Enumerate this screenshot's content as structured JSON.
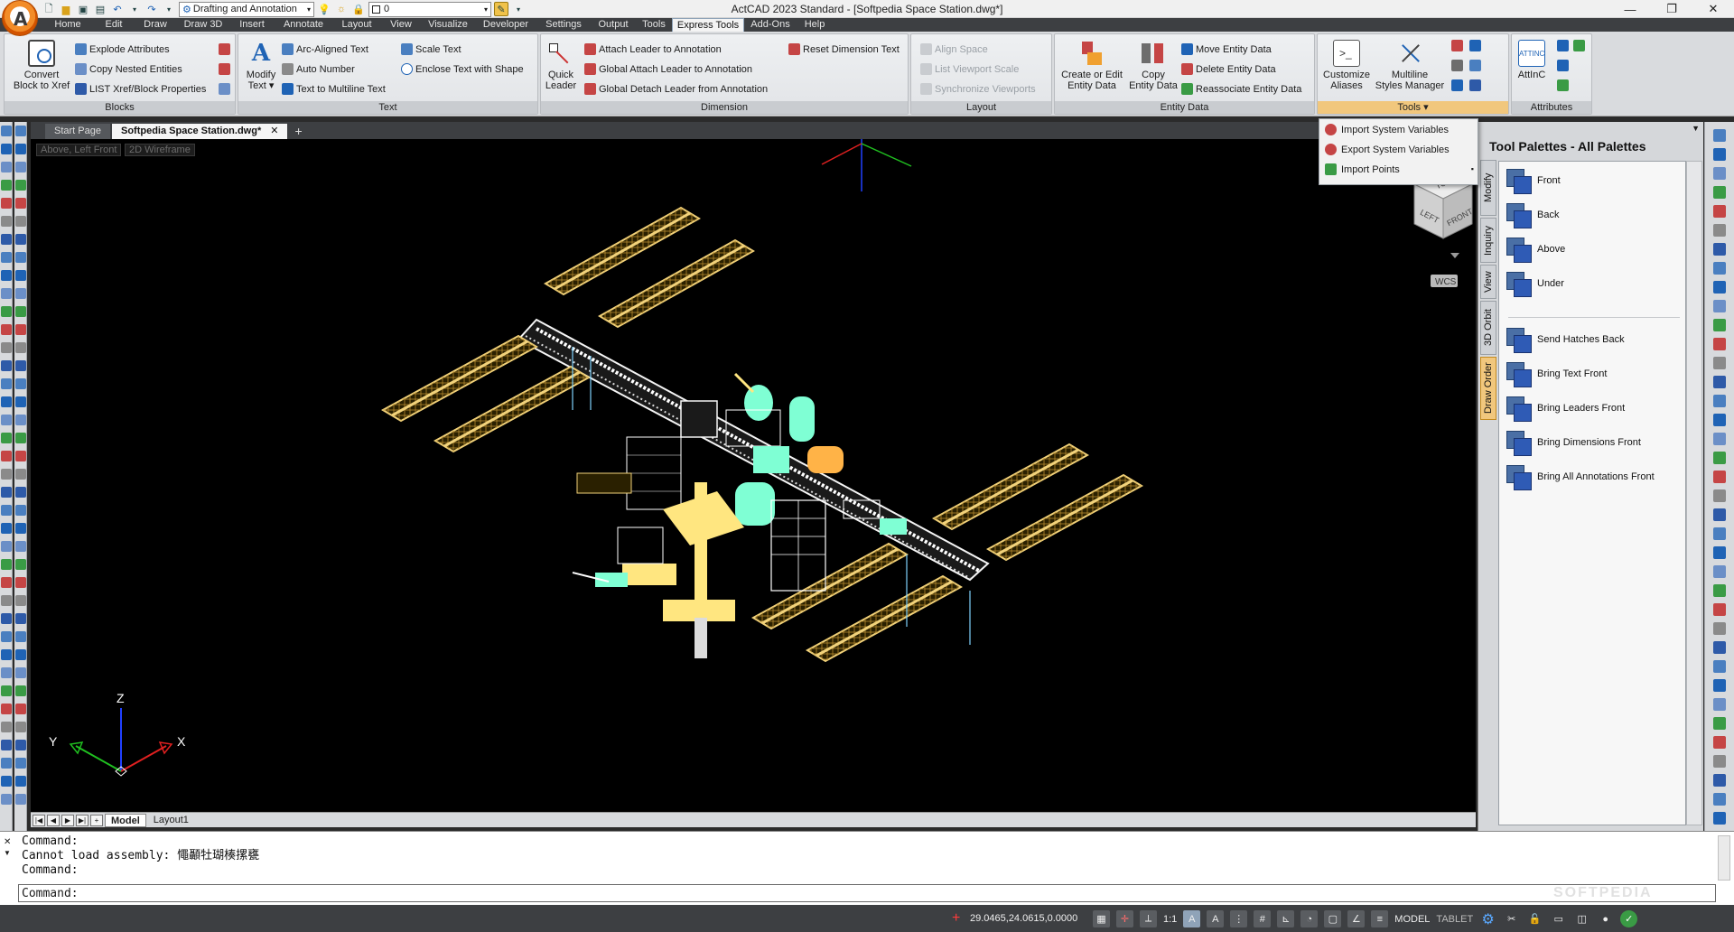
{
  "titlebar": {
    "title": "ActCAD 2023 Standard - [Softpedia Space Station.dwg*]",
    "workspace": "Drafting and Annotation",
    "layer": "0",
    "minimize": "—",
    "restore": "❐",
    "close": "✕"
  },
  "menu": {
    "tabs": [
      {
        "label": "Home",
        "w": 58
      },
      {
        "label": "Edit",
        "w": 44
      },
      {
        "label": "Draw",
        "w": 48
      },
      {
        "label": "Draw 3D",
        "w": 58
      },
      {
        "label": "Insert",
        "w": 50
      },
      {
        "label": "Annotate",
        "w": 64
      },
      {
        "label": "Layout",
        "w": 54
      },
      {
        "label": "View",
        "w": 44
      },
      {
        "label": "Visualize",
        "w": 60
      },
      {
        "label": "Developer",
        "w": 68
      },
      {
        "label": "Settings",
        "w": 60
      },
      {
        "label": "Output",
        "w": 50
      },
      {
        "label": "Tools",
        "w": 40
      },
      {
        "label": "Express Tools",
        "w": 80
      },
      {
        "label": "Add-Ons",
        "w": 58
      },
      {
        "label": "Help",
        "w": 40
      }
    ],
    "active_index": 13
  },
  "ribbon": {
    "blocks": {
      "title": "Blocks",
      "convert_line1": "Convert",
      "convert_line2": "Block to Xref",
      "explode_attributes": "Explode Attributes",
      "copy_nested": "Copy Nested Entities",
      "list_xref": "LIST Xref/Block Properties"
    },
    "text": {
      "title": "Text",
      "modify_line1": "Modify",
      "modify_line2": "Text ▾",
      "arc_aligned": "Arc-Aligned Text",
      "auto_number": "Auto Number",
      "text_to_mtext": "Text to Multiline Text",
      "scale_text": "Scale Text",
      "enclose_text": "Enclose Text with Shape"
    },
    "dimension": {
      "title": "Dimension",
      "quick_line1": "Quick",
      "quick_line2": "Leader",
      "attach_leader": "Attach Leader to Annotation",
      "global_attach": "Global Attach Leader to Annotation",
      "global_detach": "Global Detach Leader from Annotation",
      "reset_dim": "Reset Dimension Text"
    },
    "layout": {
      "title": "Layout",
      "align_space": "Align Space",
      "list_viewport": "List Viewport Scale",
      "sync_viewports": "Synchronize Viewports"
    },
    "entity_data": {
      "title": "Entity Data",
      "create_line1": "Create or Edit",
      "create_line2": "Entity Data",
      "copy_line1": "Copy",
      "copy_line2": "Entity Data",
      "move": "Move Entity Data",
      "delete": "Delete Entity Data",
      "reassociate": "Reassociate Entity Data"
    },
    "tools": {
      "title": "Tools ▾",
      "aliases_line1": "Customize",
      "aliases_line2": "Aliases",
      "mls_line1": "Multiline",
      "mls_line2": "Styles Manager"
    },
    "attributes": {
      "title": "Attributes",
      "attinc": "AttInC",
      "attinc_icon_text": "ATTINC"
    }
  },
  "tools_dropdown": {
    "import_sysvars": "Import System Variables",
    "export_sysvars": "Export System Variables",
    "import_points": "Import Points"
  },
  "documents": {
    "tabs": [
      "Start Page",
      "Softpedia Space Station.dwg*"
    ],
    "close": "✕",
    "add": "+"
  },
  "viewport": {
    "view_label": "Above, Left Front",
    "visual_style": "2D Wireframe",
    "viewcube": {
      "top": "TOP",
      "left": "LEFT",
      "front": "FRONT",
      "wcs": "WCS"
    },
    "ucs": {
      "x": "X",
      "y": "Y",
      "z": "Z"
    }
  },
  "layout_tabs": {
    "model": "Model",
    "layout1": "Layout1"
  },
  "palette": {
    "title": "Tool Palettes - All Palettes",
    "vtabs": [
      "Modify",
      "Inquiry",
      "View",
      "3D Orbit",
      "Draw Order"
    ],
    "items": [
      {
        "label": "Front"
      },
      {
        "label": "Back"
      },
      {
        "label": "Above"
      },
      {
        "label": "Under"
      },
      {
        "label": "Send Hatches Back"
      },
      {
        "label": "Bring Text Front"
      },
      {
        "label": "Bring Leaders Front"
      },
      {
        "label": "Bring Dimensions Front"
      },
      {
        "label": "Bring All Annotations Front"
      }
    ],
    "active_vtab": 4
  },
  "command": {
    "history": [
      "Command:",
      "Cannot load assembly: 憴顳牡瑚楱摞甕",
      "Command:"
    ],
    "prompt": "Command:"
  },
  "status": {
    "coords": "29.0465,24.0615,0.0000",
    "scale": "1:1",
    "model": "MODEL",
    "tablet": "TABLET"
  },
  "watermark": "SOFTPEDIA",
  "colors": {
    "accent": "#f1c77d",
    "ribbon_bg": "#d9dbde",
    "dark_chrome": "#3d3f42",
    "solar_panel": "#f2d27a",
    "solar_grid": "#c8a13e",
    "truss": "#f5f5f5",
    "module_cyan": "#7fffd4",
    "module_yellow": "#ffe680"
  }
}
